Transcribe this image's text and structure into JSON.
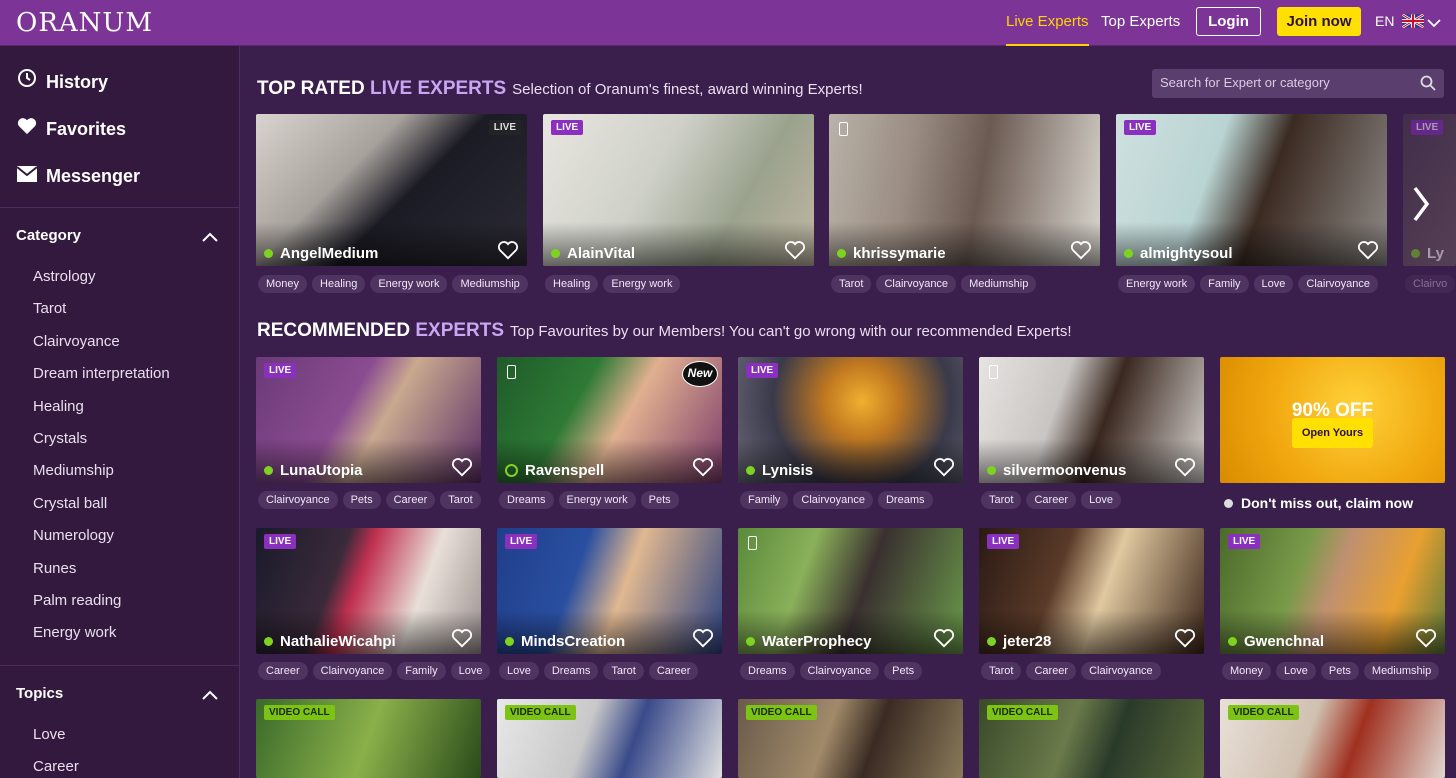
{
  "header": {
    "logo": "ORANUM",
    "nav": [
      "Live Experts",
      "Top Experts"
    ],
    "login": "Login",
    "join": "Join now",
    "lang": "EN"
  },
  "sidebar": {
    "main": [
      {
        "label": "History",
        "icon": "history-icon"
      },
      {
        "label": "Favorites",
        "icon": "heart-icon"
      },
      {
        "label": "Messenger",
        "icon": "envelope-icon"
      }
    ],
    "category_title": "Category",
    "categories": [
      "Astrology",
      "Tarot",
      "Clairvoyance",
      "Dream interpretation",
      "Healing",
      "Crystals",
      "Mediumship",
      "Crystal ball",
      "Numerology",
      "Runes",
      "Palm reading",
      "Energy work"
    ],
    "topics_title": "Topics",
    "topics": [
      "Love",
      "Career"
    ]
  },
  "search": {
    "placeholder": "Search for Expert or category"
  },
  "top_rated": {
    "title_a": "TOP RATED ",
    "title_b": "LIVE EXPERTS",
    "subtitle": "Selection of Oranum's finest, award winning Experts!",
    "experts": [
      {
        "name": "AngelMedium",
        "badge": "LIVE",
        "tags": [
          "Money",
          "Healing",
          "Energy work",
          "Mediumship"
        ]
      },
      {
        "name": "AlainVital",
        "badge": "LIVE",
        "tags": [
          "Healing",
          "Energy work"
        ]
      },
      {
        "name": "khrissymarie",
        "badge": "",
        "tags": [
          "Tarot",
          "Clairvoyance",
          "Mediumship"
        ]
      },
      {
        "name": "almightysoul",
        "badge": "LIVE",
        "tags": [
          "Energy work",
          "Family",
          "Love",
          "Clairvoyance"
        ]
      },
      {
        "name": "Ly",
        "badge": "LIVE",
        "tags": [
          "Clairvo"
        ]
      }
    ]
  },
  "recommended": {
    "title_a": "RECOMMENDED ",
    "title_b": "EXPERTS",
    "subtitle": "Top Favourites by our Members! You can't go wrong with our recommended Experts!",
    "row1": [
      {
        "name": "LunaUtopia",
        "badge": "LIVE",
        "tags": [
          "Clairvoyance",
          "Pets",
          "Career",
          "Tarot"
        ]
      },
      {
        "name": "Ravenspell",
        "badge": "New",
        "tags": [
          "Dreams",
          "Energy work",
          "Pets"
        ]
      },
      {
        "name": "Lynisis",
        "badge": "LIVE",
        "tags": [
          "Family",
          "Clairvoyance",
          "Dreams"
        ]
      },
      {
        "name": "silvermoonvenus",
        "badge": "",
        "tags": [
          "Tarot",
          "Career",
          "Love"
        ]
      }
    ],
    "promo": {
      "headline": "90% OFF",
      "button": "Open Yours",
      "caption": "Don't miss out, claim now"
    },
    "row2": [
      {
        "name": "NathalieWicahpi",
        "badge": "LIVE",
        "tags": [
          "Career",
          "Clairvoyance",
          "Family",
          "Love"
        ]
      },
      {
        "name": "MindsCreation",
        "badge": "LIVE",
        "tags": [
          "Love",
          "Dreams",
          "Tarot",
          "Career"
        ]
      },
      {
        "name": "WaterProphecy",
        "badge": "",
        "tags": [
          "Dreams",
          "Clairvoyance",
          "Pets"
        ]
      },
      {
        "name": "jeter28",
        "badge": "LIVE",
        "tags": [
          "Tarot",
          "Career",
          "Clairvoyance"
        ]
      },
      {
        "name": "Gwenchnal",
        "badge": "LIVE",
        "tags": [
          "Money",
          "Love",
          "Pets",
          "Mediumship"
        ]
      }
    ],
    "row3_badge": "VIDEO CALL"
  },
  "colors": {
    "accent": "#ffe000",
    "topbar": "#7c3496",
    "background": "#3a1f4d",
    "live_badge": "#8a2fbe",
    "online_dot": "#7ed321"
  }
}
